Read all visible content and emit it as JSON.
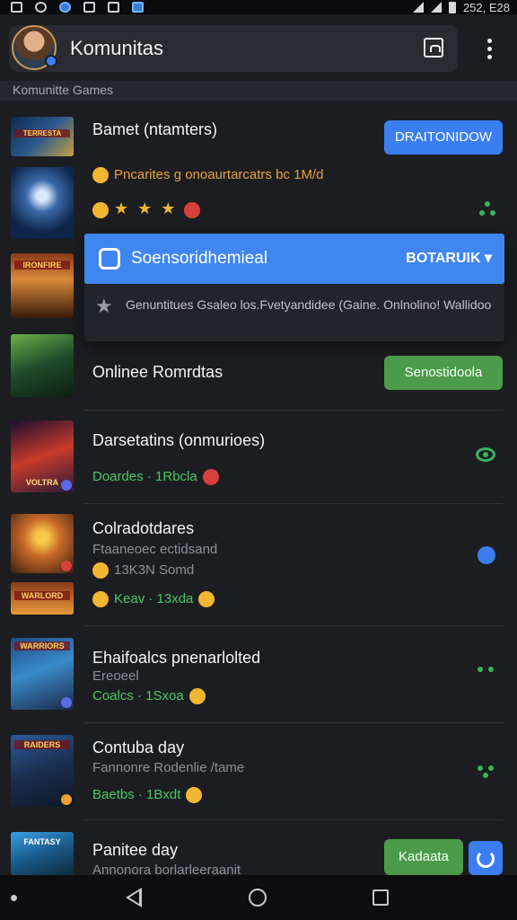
{
  "status_bar": {
    "time": "252, E28"
  },
  "app_bar": {
    "title": "Komunitas"
  },
  "breadcrumb": "Komunitte Games",
  "rows": [
    {
      "title": "Bamet (ntamters)",
      "line1": "Pncarites g onoaurtarcatrs bc 1M/d",
      "button": "DRAITONIDOW"
    },
    {
      "title": "Onlinee Romrdtas",
      "button": "Senostidoola"
    },
    {
      "title": "Darsetatins (onmurioes)",
      "meta": "Doardes · 1Rbcla"
    },
    {
      "title": "Colradotdares",
      "sub": "Ftaaneoec ectidsand",
      "sub2": "13K3N Somd",
      "meta": "Keav · 13xda"
    },
    {
      "title": "Ehaifoalcs pnenarlolted",
      "sub": "Ereoeel",
      "meta": "Coalcs · 1Sxoa"
    },
    {
      "title": "Contuba day",
      "sub": "Fannonre Rodenlie /tame",
      "meta": "Baetbs · 1Bxdt"
    },
    {
      "title": "Panitee day",
      "sub": "Annonora borlarleeraanit",
      "button": "Kadaata"
    }
  ],
  "card": {
    "title": "Soensoridhemieal",
    "action": "BOTARUIK",
    "description": "Genuntitues Gsaleo los.Fvetyandidee (Gaine. Onlnolino! Wallidoo"
  },
  "thumb_tags": [
    "TERRESTA",
    "IRONFIRE",
    "VOLTRA",
    "WARLORD",
    "WARRIORS",
    "RAIDERS",
    "FANTASY"
  ],
  "colors": {
    "accent_blue": "#3b7ef0",
    "accent_green": "#39b45c",
    "background": "#1c1d21"
  }
}
